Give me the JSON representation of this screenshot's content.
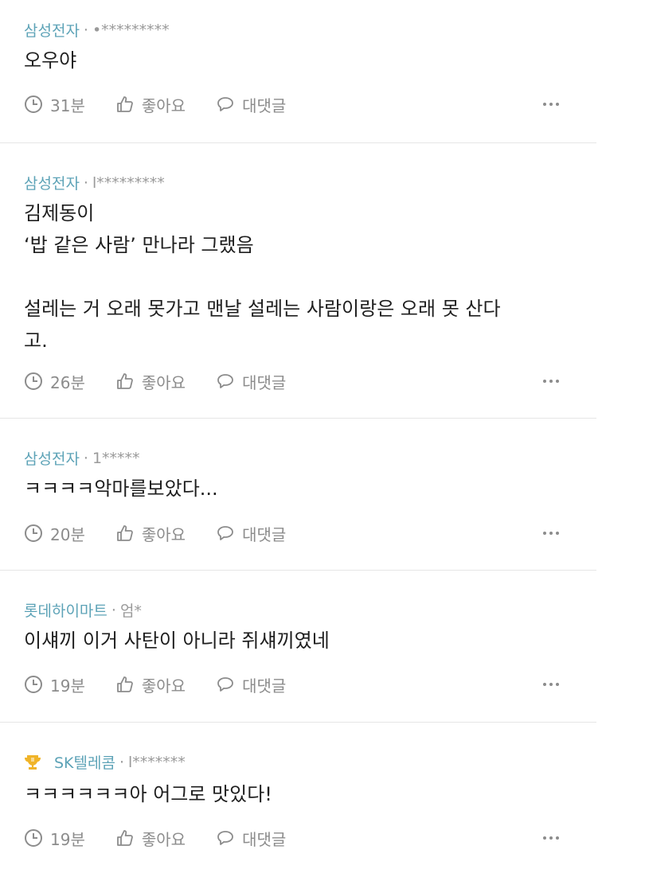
{
  "comments": [
    {
      "company": "삼성전자",
      "author": "•*********",
      "text": "오우야",
      "time": "31분",
      "like_label": "좋아요",
      "reply_label": "대댓글"
    },
    {
      "company": "삼성전자",
      "author": "l*********",
      "text": "김제동이\n‘밥 같은 사람’ 만나라 그랬음\n\n설레는 거 오래 못가고 맨날 설레는 사람이랑은 오래 못 산다\n고.",
      "time": "26분",
      "like_label": "좋아요",
      "reply_label": "대댓글"
    },
    {
      "company": "삼성전자",
      "author": "1*****",
      "text": "ㅋㅋㅋㅋ악마를보았다...",
      "time": "20분",
      "like_label": "좋아요",
      "reply_label": "대댓글"
    },
    {
      "company": "롯데하이마트",
      "author": "엄*",
      "text": "이섀끼 이거 사탄이 아니라 쥐섀끼였네",
      "time": "19분",
      "like_label": "좋아요",
      "reply_label": "대댓글"
    },
    {
      "company": "SK텔레콤",
      "author": "l*******",
      "text": "ㅋㅋㅋㅋㅋㅋ아 어그로 맛있다!",
      "time": "19분",
      "like_label": "좋아요",
      "reply_label": "대댓글",
      "badge_icon": "trophy-icon"
    }
  ],
  "separator": "·",
  "more_icon": "more-icon",
  "colors": {
    "company": "#5da3b7",
    "meta": "#9a9a9a",
    "text": "#1e1e1e",
    "action": "#8c8c8c",
    "badge": "#f0b429"
  }
}
